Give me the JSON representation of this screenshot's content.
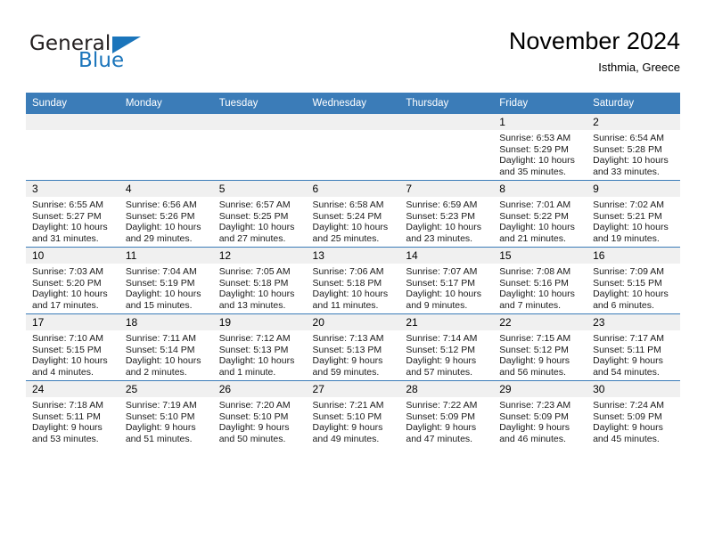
{
  "brand": {
    "general": "General",
    "blue": "Blue",
    "triangle_color": "#1b75bb"
  },
  "header": {
    "month_title": "November 2024",
    "location": "Isthmia, Greece"
  },
  "theme": {
    "header_bg": "#3b7cb8",
    "daynum_bg": "#f0f0f0",
    "text": "#000000"
  },
  "calendar": {
    "weekday_headers": [
      "Sunday",
      "Monday",
      "Tuesday",
      "Wednesday",
      "Thursday",
      "Friday",
      "Saturday"
    ],
    "weeks": [
      [
        {
          "day": "",
          "sunrise": "",
          "sunset": "",
          "daylight_line1": "",
          "daylight_line2": ""
        },
        {
          "day": "",
          "sunrise": "",
          "sunset": "",
          "daylight_line1": "",
          "daylight_line2": ""
        },
        {
          "day": "",
          "sunrise": "",
          "sunset": "",
          "daylight_line1": "",
          "daylight_line2": ""
        },
        {
          "day": "",
          "sunrise": "",
          "sunset": "",
          "daylight_line1": "",
          "daylight_line2": ""
        },
        {
          "day": "",
          "sunrise": "",
          "sunset": "",
          "daylight_line1": "",
          "daylight_line2": ""
        },
        {
          "day": "1",
          "sunrise": "Sunrise: 6:53 AM",
          "sunset": "Sunset: 5:29 PM",
          "daylight_line1": "Daylight: 10 hours",
          "daylight_line2": "and 35 minutes."
        },
        {
          "day": "2",
          "sunrise": "Sunrise: 6:54 AM",
          "sunset": "Sunset: 5:28 PM",
          "daylight_line1": "Daylight: 10 hours",
          "daylight_line2": "and 33 minutes."
        }
      ],
      [
        {
          "day": "3",
          "sunrise": "Sunrise: 6:55 AM",
          "sunset": "Sunset: 5:27 PM",
          "daylight_line1": "Daylight: 10 hours",
          "daylight_line2": "and 31 minutes."
        },
        {
          "day": "4",
          "sunrise": "Sunrise: 6:56 AM",
          "sunset": "Sunset: 5:26 PM",
          "daylight_line1": "Daylight: 10 hours",
          "daylight_line2": "and 29 minutes."
        },
        {
          "day": "5",
          "sunrise": "Sunrise: 6:57 AM",
          "sunset": "Sunset: 5:25 PM",
          "daylight_line1": "Daylight: 10 hours",
          "daylight_line2": "and 27 minutes."
        },
        {
          "day": "6",
          "sunrise": "Sunrise: 6:58 AM",
          "sunset": "Sunset: 5:24 PM",
          "daylight_line1": "Daylight: 10 hours",
          "daylight_line2": "and 25 minutes."
        },
        {
          "day": "7",
          "sunrise": "Sunrise: 6:59 AM",
          "sunset": "Sunset: 5:23 PM",
          "daylight_line1": "Daylight: 10 hours",
          "daylight_line2": "and 23 minutes."
        },
        {
          "day": "8",
          "sunrise": "Sunrise: 7:01 AM",
          "sunset": "Sunset: 5:22 PM",
          "daylight_line1": "Daylight: 10 hours",
          "daylight_line2": "and 21 minutes."
        },
        {
          "day": "9",
          "sunrise": "Sunrise: 7:02 AM",
          "sunset": "Sunset: 5:21 PM",
          "daylight_line1": "Daylight: 10 hours",
          "daylight_line2": "and 19 minutes."
        }
      ],
      [
        {
          "day": "10",
          "sunrise": "Sunrise: 7:03 AM",
          "sunset": "Sunset: 5:20 PM",
          "daylight_line1": "Daylight: 10 hours",
          "daylight_line2": "and 17 minutes."
        },
        {
          "day": "11",
          "sunrise": "Sunrise: 7:04 AM",
          "sunset": "Sunset: 5:19 PM",
          "daylight_line1": "Daylight: 10 hours",
          "daylight_line2": "and 15 minutes."
        },
        {
          "day": "12",
          "sunrise": "Sunrise: 7:05 AM",
          "sunset": "Sunset: 5:18 PM",
          "daylight_line1": "Daylight: 10 hours",
          "daylight_line2": "and 13 minutes."
        },
        {
          "day": "13",
          "sunrise": "Sunrise: 7:06 AM",
          "sunset": "Sunset: 5:18 PM",
          "daylight_line1": "Daylight: 10 hours",
          "daylight_line2": "and 11 minutes."
        },
        {
          "day": "14",
          "sunrise": "Sunrise: 7:07 AM",
          "sunset": "Sunset: 5:17 PM",
          "daylight_line1": "Daylight: 10 hours",
          "daylight_line2": "and 9 minutes."
        },
        {
          "day": "15",
          "sunrise": "Sunrise: 7:08 AM",
          "sunset": "Sunset: 5:16 PM",
          "daylight_line1": "Daylight: 10 hours",
          "daylight_line2": "and 7 minutes."
        },
        {
          "day": "16",
          "sunrise": "Sunrise: 7:09 AM",
          "sunset": "Sunset: 5:15 PM",
          "daylight_line1": "Daylight: 10 hours",
          "daylight_line2": "and 6 minutes."
        }
      ],
      [
        {
          "day": "17",
          "sunrise": "Sunrise: 7:10 AM",
          "sunset": "Sunset: 5:15 PM",
          "daylight_line1": "Daylight: 10 hours",
          "daylight_line2": "and 4 minutes."
        },
        {
          "day": "18",
          "sunrise": "Sunrise: 7:11 AM",
          "sunset": "Sunset: 5:14 PM",
          "daylight_line1": "Daylight: 10 hours",
          "daylight_line2": "and 2 minutes."
        },
        {
          "day": "19",
          "sunrise": "Sunrise: 7:12 AM",
          "sunset": "Sunset: 5:13 PM",
          "daylight_line1": "Daylight: 10 hours",
          "daylight_line2": "and 1 minute."
        },
        {
          "day": "20",
          "sunrise": "Sunrise: 7:13 AM",
          "sunset": "Sunset: 5:13 PM",
          "daylight_line1": "Daylight: 9 hours",
          "daylight_line2": "and 59 minutes."
        },
        {
          "day": "21",
          "sunrise": "Sunrise: 7:14 AM",
          "sunset": "Sunset: 5:12 PM",
          "daylight_line1": "Daylight: 9 hours",
          "daylight_line2": "and 57 minutes."
        },
        {
          "day": "22",
          "sunrise": "Sunrise: 7:15 AM",
          "sunset": "Sunset: 5:12 PM",
          "daylight_line1": "Daylight: 9 hours",
          "daylight_line2": "and 56 minutes."
        },
        {
          "day": "23",
          "sunrise": "Sunrise: 7:17 AM",
          "sunset": "Sunset: 5:11 PM",
          "daylight_line1": "Daylight: 9 hours",
          "daylight_line2": "and 54 minutes."
        }
      ],
      [
        {
          "day": "24",
          "sunrise": "Sunrise: 7:18 AM",
          "sunset": "Sunset: 5:11 PM",
          "daylight_line1": "Daylight: 9 hours",
          "daylight_line2": "and 53 minutes."
        },
        {
          "day": "25",
          "sunrise": "Sunrise: 7:19 AM",
          "sunset": "Sunset: 5:10 PM",
          "daylight_line1": "Daylight: 9 hours",
          "daylight_line2": "and 51 minutes."
        },
        {
          "day": "26",
          "sunrise": "Sunrise: 7:20 AM",
          "sunset": "Sunset: 5:10 PM",
          "daylight_line1": "Daylight: 9 hours",
          "daylight_line2": "and 50 minutes."
        },
        {
          "day": "27",
          "sunrise": "Sunrise: 7:21 AM",
          "sunset": "Sunset: 5:10 PM",
          "daylight_line1": "Daylight: 9 hours",
          "daylight_line2": "and 49 minutes."
        },
        {
          "day": "28",
          "sunrise": "Sunrise: 7:22 AM",
          "sunset": "Sunset: 5:09 PM",
          "daylight_line1": "Daylight: 9 hours",
          "daylight_line2": "and 47 minutes."
        },
        {
          "day": "29",
          "sunrise": "Sunrise: 7:23 AM",
          "sunset": "Sunset: 5:09 PM",
          "daylight_line1": "Daylight: 9 hours",
          "daylight_line2": "and 46 minutes."
        },
        {
          "day": "30",
          "sunrise": "Sunrise: 7:24 AM",
          "sunset": "Sunset: 5:09 PM",
          "daylight_line1": "Daylight: 9 hours",
          "daylight_line2": "and 45 minutes."
        }
      ]
    ]
  }
}
